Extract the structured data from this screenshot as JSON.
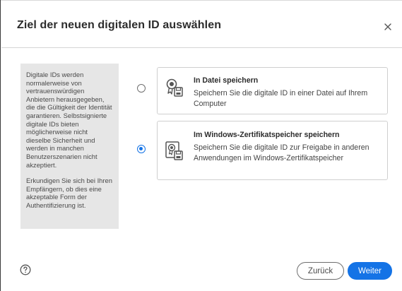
{
  "dialog": {
    "title": "Ziel der neuen digitalen ID auswählen",
    "close_icon": "close-icon"
  },
  "info_panel": {
    "paragraph_1": "Digitale IDs werden normalerweise von vertrauenswürdigen Anbietern herausgegeben, die die Gültigkeit der Identität garantieren. Selbstsignierte digitale IDs bieten möglicherweise nicht dieselbe Sicherheit und werden in manchen Benutzerszenarien nicht akzeptiert.",
    "paragraph_2": "Erkundigen Sie sich bei Ihren Empfängern, ob dies eine akzeptable Form der Authentifizierung ist."
  },
  "options": [
    {
      "title": "In Datei speichern",
      "description": "Speichern Sie die digitale ID in einer Datei auf Ihrem Computer",
      "selected": false,
      "icon": "certificate-file-icon"
    },
    {
      "title": "Im Windows-Zertifikatspeicher speichern",
      "description": "Speichern Sie die digitale ID zur Freigabe in anderen Anwendungen im Windows-Zertifikatspeicher",
      "selected": true,
      "icon": "certificate-store-icon"
    }
  ],
  "footer": {
    "help_icon": "help-icon",
    "back_label": "Zurück",
    "next_label": "Weiter"
  },
  "colors": {
    "accent": "#1473e6",
    "panel_bg": "#e6e6e6",
    "border": "#cfcfcf"
  }
}
